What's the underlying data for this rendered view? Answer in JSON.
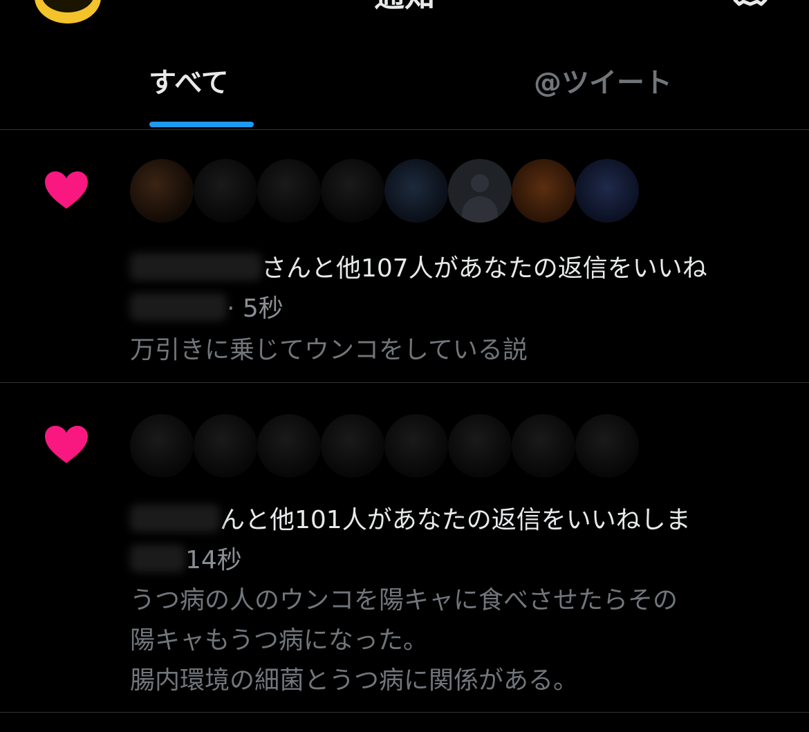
{
  "header": {
    "title": "通知",
    "avatar_icon": "user-avatar-icon",
    "settings_icon": "gear-icon"
  },
  "tabs": [
    {
      "label": "すべて",
      "active": true
    },
    {
      "label": "@ツイート",
      "active": false
    }
  ],
  "colors": {
    "background": "#000000",
    "accent": "#1d9bf0",
    "like": "#f91880",
    "text_primary": "#e7e9ea",
    "text_secondary": "#71767b",
    "divider": "#2f3336"
  },
  "notifications": [
    {
      "icon": "heart-icon",
      "line1": "さんと他107人があなたの返信をいいね",
      "line2_meta": "· 5秒",
      "tweet_lines": [
        "万引きに乗じてウンコをしている説"
      ]
    },
    {
      "icon": "heart-icon",
      "line1": "んと他101人があなたの返信をいいねしま",
      "line2_meta": "14秒",
      "tweet_lines": [
        "うつ病の人のウンコを陽キャに食べさせたらその",
        "陽キャもうつ病になった。",
        "腸内環境の細菌とうつ病に関係がある。"
      ]
    }
  ]
}
